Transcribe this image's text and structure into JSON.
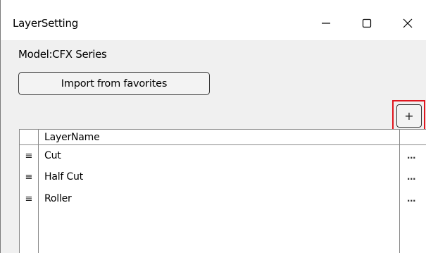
{
  "window": {
    "title": "LayerSetting",
    "minimize_glyph": "minimize-icon",
    "maximize_glyph": "maximize-icon",
    "close_glyph": "close-icon"
  },
  "model": {
    "label": "Model:CFX Series"
  },
  "toolbar": {
    "import_label": "Import from favorites",
    "add_label": "+"
  },
  "grid": {
    "header": {
      "layer_name": "LayerName"
    },
    "rows": [
      {
        "handle": "≡",
        "name": "Cut",
        "more": "..."
      },
      {
        "handle": "≡",
        "name": "Half Cut",
        "more": "..."
      },
      {
        "handle": "≡",
        "name": "Roller",
        "more": "..."
      }
    ]
  },
  "colors": {
    "highlight": "#e0161f",
    "border": "#333333",
    "window_bg": "#f0f0f0"
  }
}
